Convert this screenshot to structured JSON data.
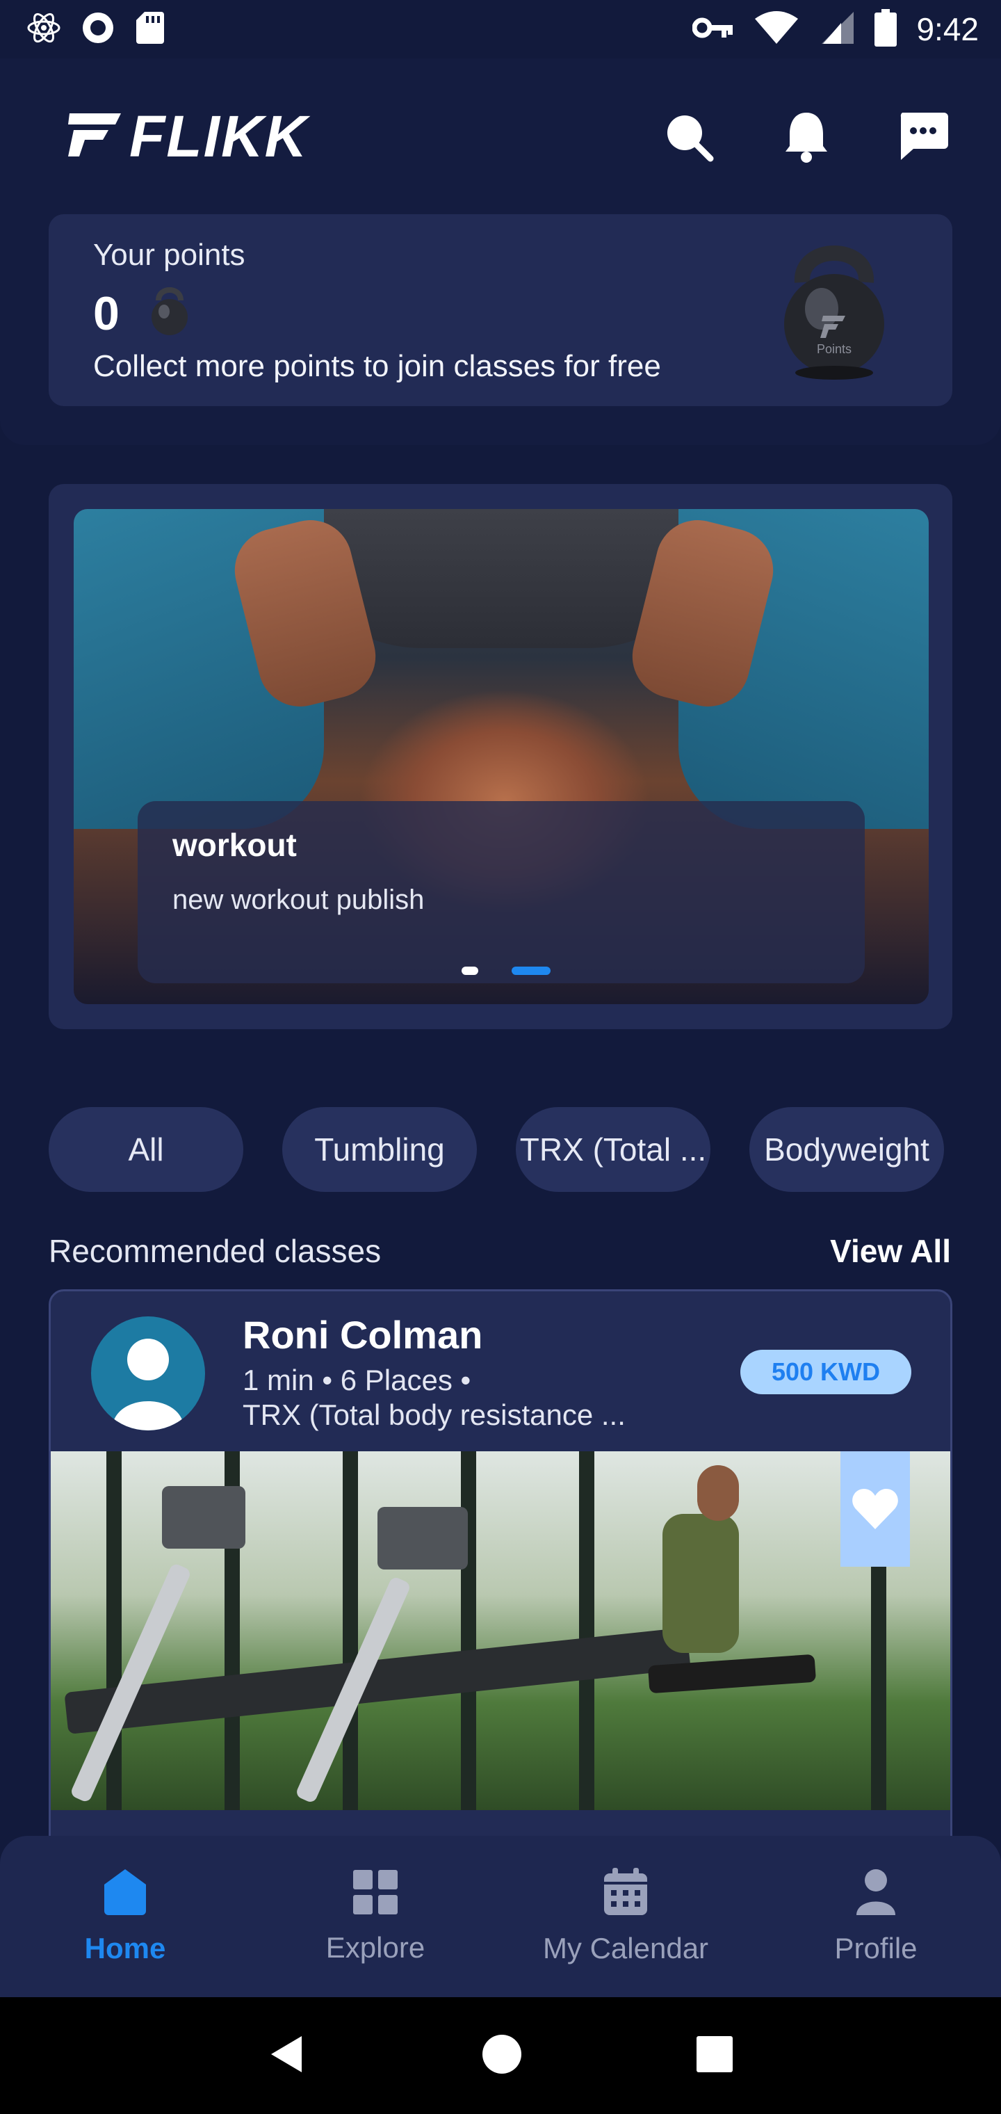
{
  "status_bar": {
    "time": "9:42",
    "left_icons": [
      "atom-icon",
      "record-icon",
      "sd-card-icon"
    ],
    "right_icons": [
      "vpn-key-icon",
      "wifi-icon",
      "signal-icon",
      "battery-icon"
    ]
  },
  "header": {
    "logo_text": "FLIKK",
    "icons": [
      "search-icon",
      "bell-icon",
      "chat-icon"
    ]
  },
  "points": {
    "label": "Your points",
    "value": "0",
    "description": "Collect more points to join classes for free",
    "kettlebell_text": "Points"
  },
  "banner": {
    "title": "workout",
    "subtitle": "new workout publish",
    "slides_total": 2,
    "active_slide": 2
  },
  "categories": [
    "All",
    "Tumbling",
    "TRX (Total ...",
    "Bodyweight"
  ],
  "recommended": {
    "section_title": "Recommended classes",
    "view_all": "View All",
    "card": {
      "trainer": "Roni Colman",
      "meta": "1 min • 6 Places •",
      "class_type": "TRX (Total body resistance ...",
      "price": "500 KWD",
      "favorite": true
    }
  },
  "bottom_nav": {
    "items": [
      {
        "label": "Home",
        "icon": "home-icon",
        "active": true
      },
      {
        "label": "Explore",
        "icon": "grid-icon",
        "active": false
      },
      {
        "label": "My Calendar",
        "icon": "calendar-icon",
        "active": false
      },
      {
        "label": "Profile",
        "icon": "person-icon",
        "active": false
      }
    ]
  },
  "colors": {
    "background": "#121a3c",
    "card": "#222b55",
    "accent": "#1e88f0",
    "inactive": "#9aa1bb",
    "price_badge_bg": "#a9d4ff"
  }
}
